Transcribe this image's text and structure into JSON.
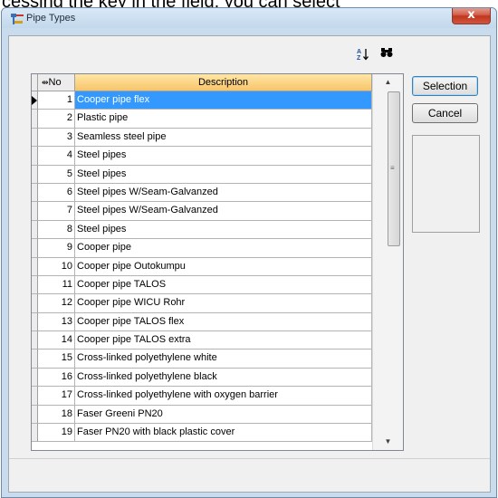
{
  "background_text": "cessing the key in the field, you can select",
  "window": {
    "title": "Pipe Types",
    "close_label": "x"
  },
  "toolbar": {
    "sort_icon": "sort-az-icon",
    "find_icon": "binoculars-icon"
  },
  "grid": {
    "columns": [
      "No",
      "Description"
    ],
    "selected_index": 0,
    "rows": [
      {
        "no": "1",
        "description": "Cooper pipe flex"
      },
      {
        "no": "2",
        "description": "Plastic pipe"
      },
      {
        "no": "3",
        "description": "Seamless steel pipe"
      },
      {
        "no": "4",
        "description": "Steel pipes"
      },
      {
        "no": "5",
        "description": "Steel pipes"
      },
      {
        "no": "6",
        "description": "Steel pipes W/Seam-Galvanzed"
      },
      {
        "no": "7",
        "description": "Steel pipes W/Seam-Galvanzed"
      },
      {
        "no": "8",
        "description": "Steel pipes"
      },
      {
        "no": "9",
        "description": "Cooper pipe"
      },
      {
        "no": "10",
        "description": "Cooper pipe Outokumpu"
      },
      {
        "no": "11",
        "description": "Cooper pipe TALOS"
      },
      {
        "no": "12",
        "description": "Cooper pipe  WICU Rohr"
      },
      {
        "no": "13",
        "description": "Cooper pipe TALOS flex"
      },
      {
        "no": "14",
        "description": "Cooper pipe TALOS extra"
      },
      {
        "no": "15",
        "description": "Cross-linked polyethylene white"
      },
      {
        "no": "16",
        "description": "Cross-linked polyethylene black"
      },
      {
        "no": "17",
        "description": "Cross-linked polyethylene with oxygen barrier"
      },
      {
        "no": "18",
        "description": "Faser Greeni PN20"
      },
      {
        "no": "19",
        "description": "Faser PN20 with black plastic cover"
      }
    ]
  },
  "buttons": {
    "selection": "Selection",
    "cancel": "Cancel"
  },
  "colors": {
    "selection_highlight": "#3399ff",
    "header_highlight": "#f7c46a"
  }
}
